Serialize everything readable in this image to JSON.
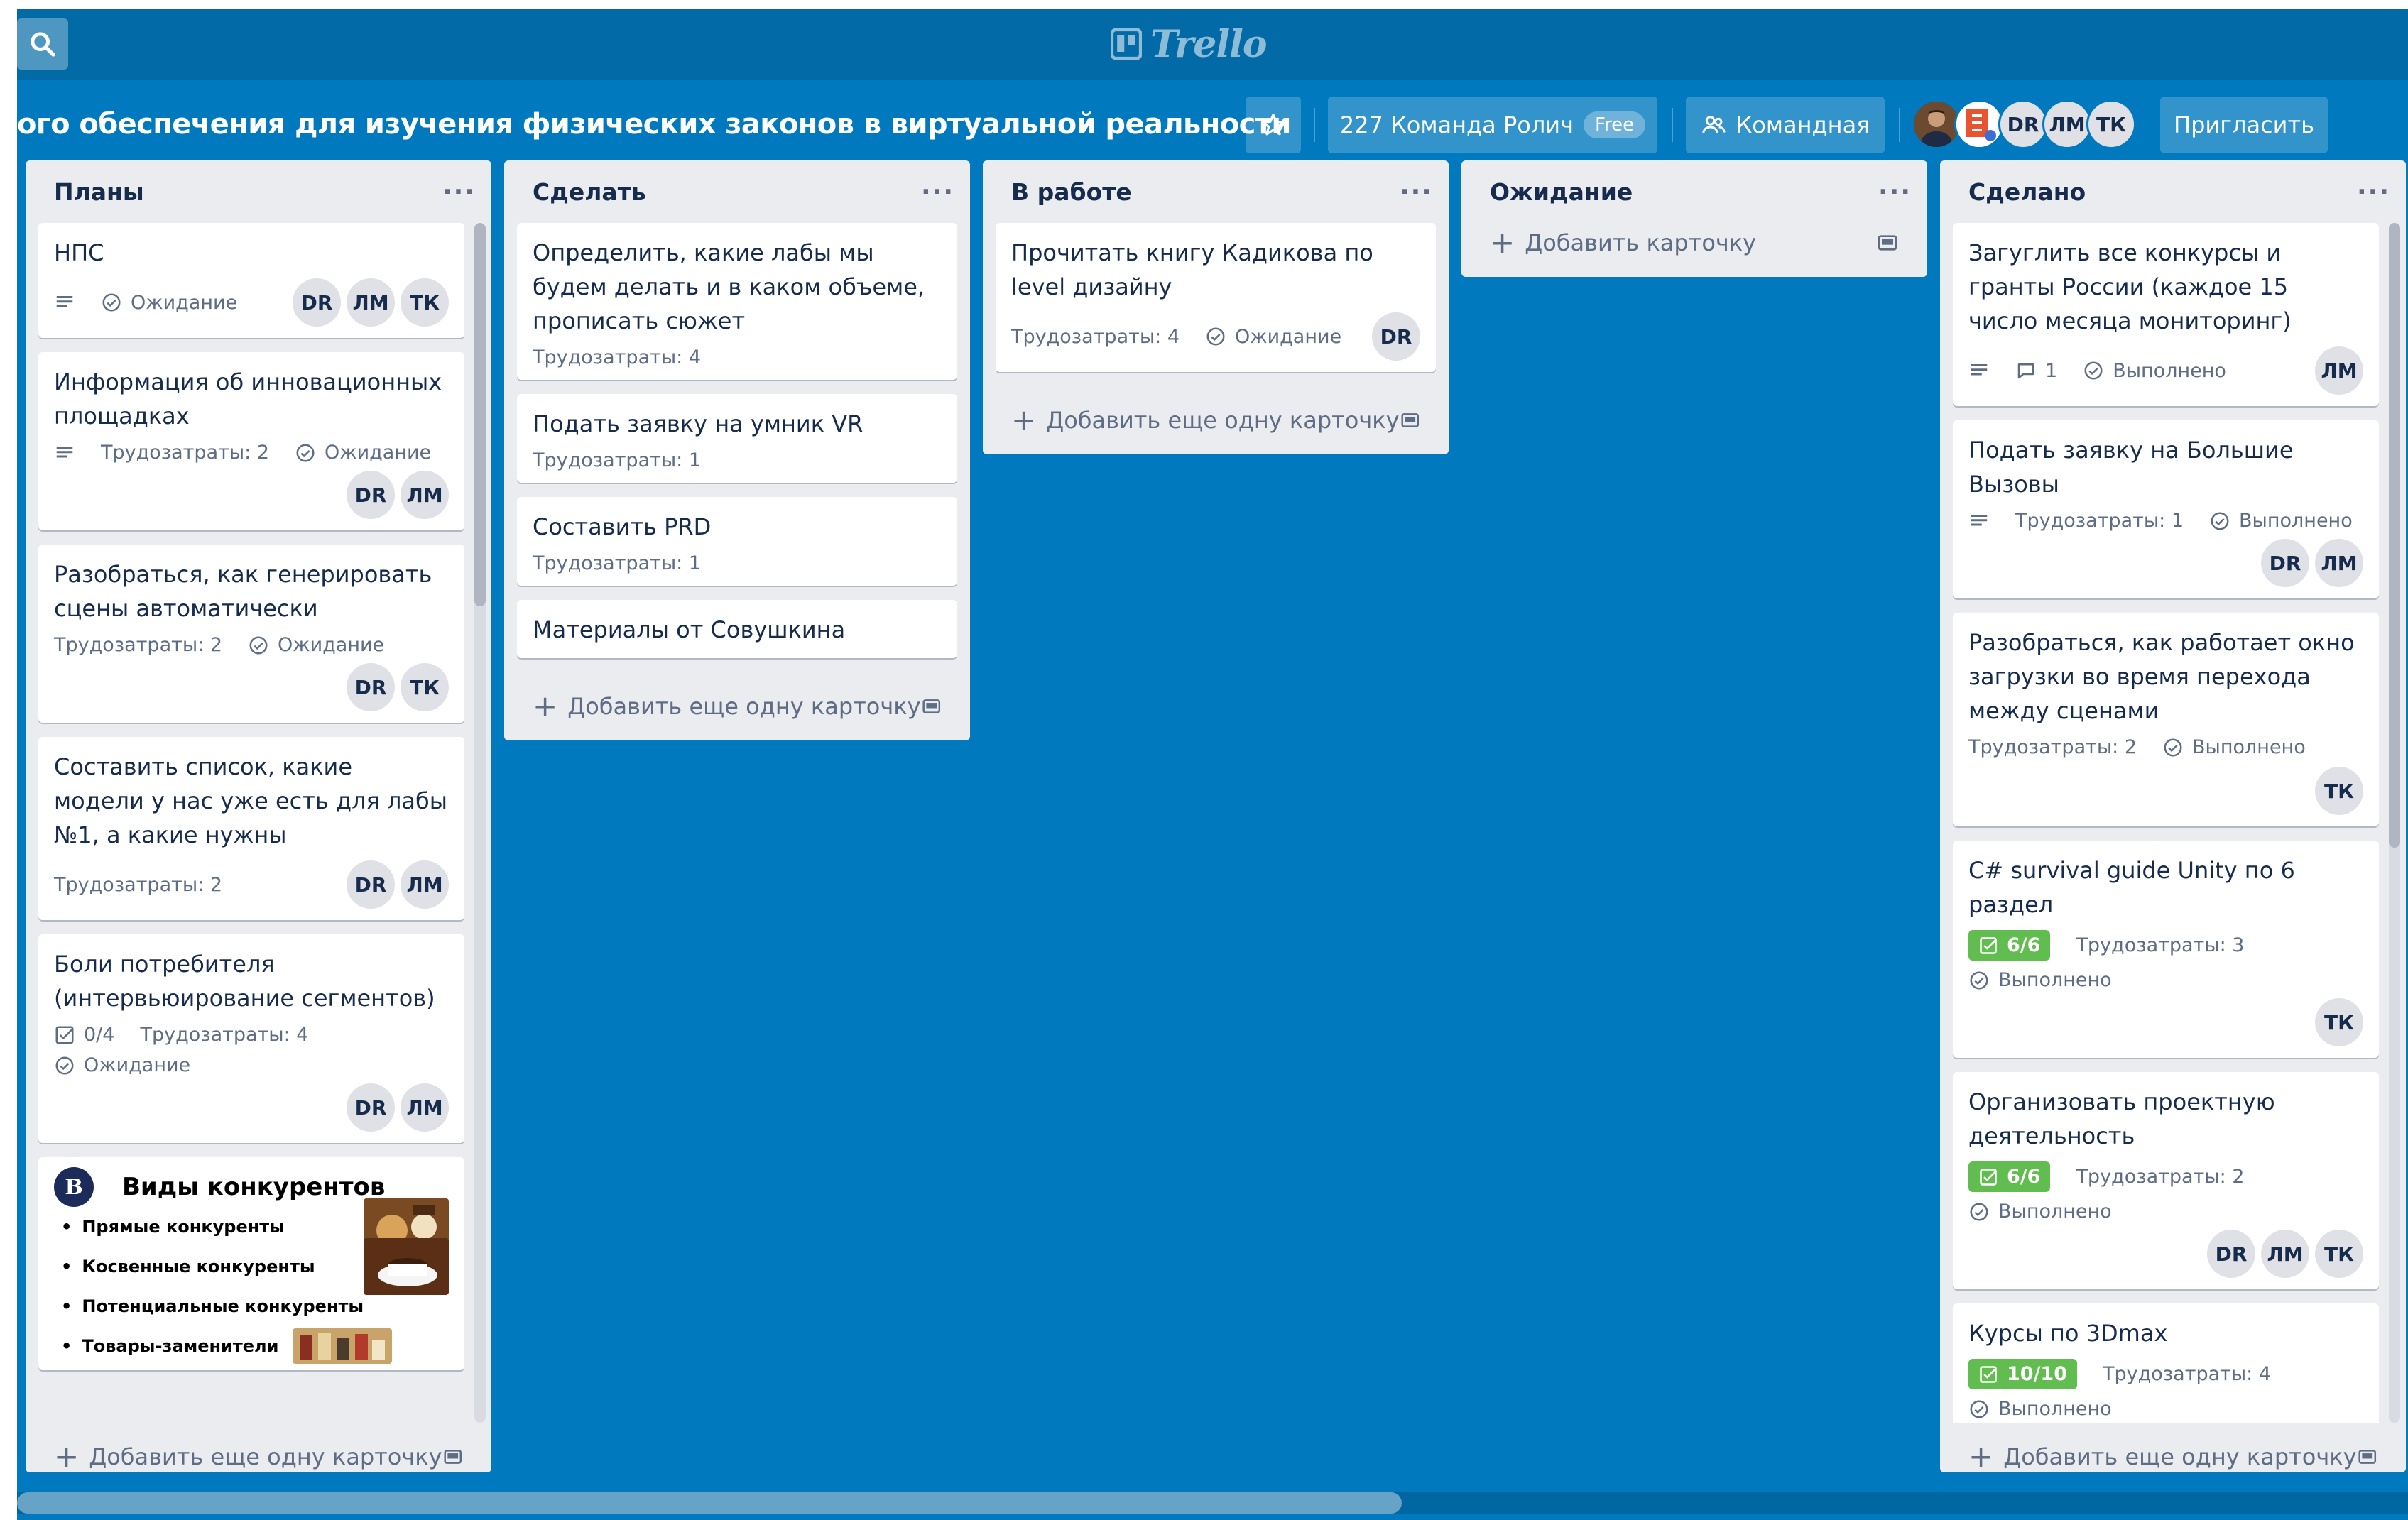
{
  "topbar": {
    "logo_text": "Trello"
  },
  "board": {
    "title": "ого обеспечения для изучения физических законов в виртуальной реальности",
    "team_label": "227 Команда Ролич",
    "team_plan": "Free",
    "visibility_label": "Командная",
    "invite_label": "Пригласить",
    "members": [
      "DR",
      "ЛМ",
      "ТК"
    ]
  },
  "lists": [
    {
      "title": "Планы",
      "add_label": "Добавить еще одну карточку",
      "cards": [
        {
          "title": "НПС",
          "status": "Ожидание",
          "avatars": [
            "DR",
            "ЛМ",
            "ТК"
          ]
        },
        {
          "title": "Информация об инновационных площадках",
          "effort": "Трудозатраты: 2",
          "status": "Ожидание",
          "avatars": [
            "DR",
            "ЛМ"
          ]
        },
        {
          "title": "Разобраться, как генерировать сцены автоматически",
          "effort": "Трудозатраты: 2",
          "status": "Ожидание",
          "avatars": [
            "DR",
            "ТК"
          ]
        },
        {
          "title": "Составить список, какие модели у нас уже есть для лабы №1, а какие нужны",
          "effort": "Трудозатраты: 2",
          "avatars": [
            "DR",
            "ЛМ"
          ]
        },
        {
          "title": "Боли потребителя (интервьюирование сегментов)",
          "checklist": "0/4",
          "effort": "Трудозатраты: 4",
          "status": "Ожидание",
          "avatars": [
            "DR",
            "ЛМ"
          ]
        }
      ],
      "cover_card": {
        "logo_letter": "В",
        "title": "Виды конкурентов",
        "items": [
          "Прямые конкуренты",
          "Косвенные конкуренты",
          "Потенциальные конкуренты",
          "Товары-заменители"
        ]
      }
    },
    {
      "title": "Сделать",
      "add_label": "Добавить еще одну карточку",
      "cards": [
        {
          "title": "Определить, какие лабы мы будем делать и в каком объеме, прописать сюжет",
          "effort": "Трудозатраты: 4"
        },
        {
          "title": "Подать заявку на умник VR",
          "effort": "Трудозатраты: 1"
        },
        {
          "title": "Составить PRD",
          "effort": "Трудозатраты: 1"
        },
        {
          "title": "Материалы от Совушкина"
        }
      ]
    },
    {
      "title": "В работе",
      "add_label": "Добавить еще одну карточку",
      "cards": [
        {
          "title": "Прочитать книгу Кадикова по level дизайну",
          "effort": "Трудозатраты: 4",
          "status": "Ожидание",
          "avatar": "DR"
        }
      ]
    },
    {
      "title": "Ожидание",
      "add_label": "Добавить карточку",
      "cards": []
    },
    {
      "title": "Сделано",
      "add_label": "Добавить еще одну карточку",
      "cards": [
        {
          "title": "Загуглить все конкурсы и гранты России (каждое 15 число месяца мониторинг)",
          "comments": "1",
          "status": "Выполнено",
          "avatar": "ЛМ"
        },
        {
          "title": "Подать заявку на Большие Вызовы",
          "effort": "Трудозатраты: 1",
          "status": "Выполнено",
          "avatars": [
            "DR",
            "ЛМ"
          ]
        },
        {
          "title": "Разобраться, как работает окно загрузки во время перехода между сценами",
          "effort": "Трудозатраты: 2",
          "status": "Выполнено",
          "avatar": "ТК"
        },
        {
          "title": "C# survival guide Unity по 6 раздел",
          "checklist": "6/6",
          "effort": "Трудозатраты: 3",
          "status": "Выполнено",
          "avatars": [
            "ТК"
          ]
        },
        {
          "title": "Организовать проектную деятельность",
          "checklist": "6/6",
          "effort": "Трудозатраты: 2",
          "status": "Выполнено",
          "avatars": [
            "DR",
            "ЛМ",
            "ТК"
          ]
        },
        {
          "title": "Курсы по 3Dmax",
          "checklist": "10/10",
          "effort": "Трудозатраты: 4",
          "status": "Выполнено"
        }
      ]
    }
  ],
  "colors": {
    "board_bg": "#0079bf",
    "header_bg": "#026aa7",
    "list_bg": "#ebecf0",
    "checklist_done": "#61bd4f"
  }
}
